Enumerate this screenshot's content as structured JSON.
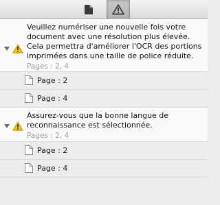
{
  "toolbar": {
    "tabs": [
      {
        "name": "document-tab",
        "icon": "document-icon",
        "selected": false
      },
      {
        "name": "warnings-tab",
        "icon": "warning-icon",
        "selected": true
      }
    ]
  },
  "groups": [
    {
      "message": "Veuillez numériser une nouvelle fois votre document avec une résolution plus élevée. Cela permettra d'améliorer l'OCR des portions imprimées dans une taille de police réduite.",
      "pages_summary": "Pages : 2, 4",
      "items": [
        {
          "label": "Page : 2"
        },
        {
          "label": "Page : 4"
        }
      ]
    },
    {
      "message": "Assurez-vous que la bonne langue de reconnaissance est sélectionnée.",
      "pages_summary": "Pages : 2, 4",
      "items": [
        {
          "label": "Page : 2"
        },
        {
          "label": "Page : 4"
        }
      ]
    }
  ],
  "colors": {
    "warning_fill": "#f2c200",
    "header_bg": "#fafafa",
    "row_bg": "#ececec",
    "muted_text": "#9d9d9d"
  }
}
